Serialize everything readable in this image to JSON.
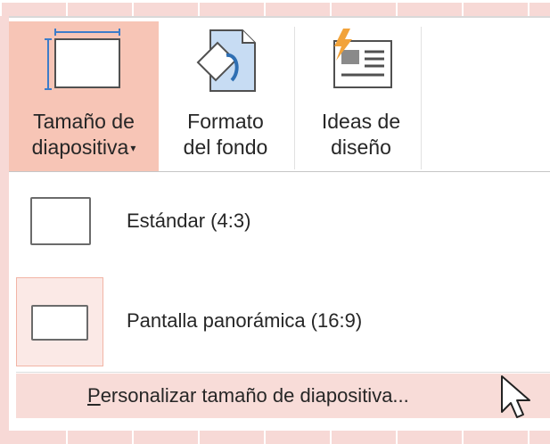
{
  "ribbon": {
    "slide_size": {
      "line1": "Tamaño de",
      "line2": "diapositiva",
      "caret": "▾"
    },
    "format_background": {
      "line1": "Formato",
      "line2": "del fondo"
    },
    "design_ideas": {
      "line1": "Ideas de",
      "line2": "diseño"
    }
  },
  "dropdown": {
    "options": [
      {
        "label": "Estándar (4:3)"
      },
      {
        "label": "Pantalla panorámica (16:9)"
      }
    ],
    "custom": {
      "mnemonic": "P",
      "rest": "ersonalizar tamaño de diapositiva..."
    }
  },
  "colors": {
    "highlight": "#f7c5b6",
    "hover": "#f8dcd8",
    "background_grid": "#f7d9d6"
  },
  "icons": [
    "slide-size-icon",
    "format-background-icon",
    "design-ideas-icon",
    "mouse-pointer-icon"
  ]
}
